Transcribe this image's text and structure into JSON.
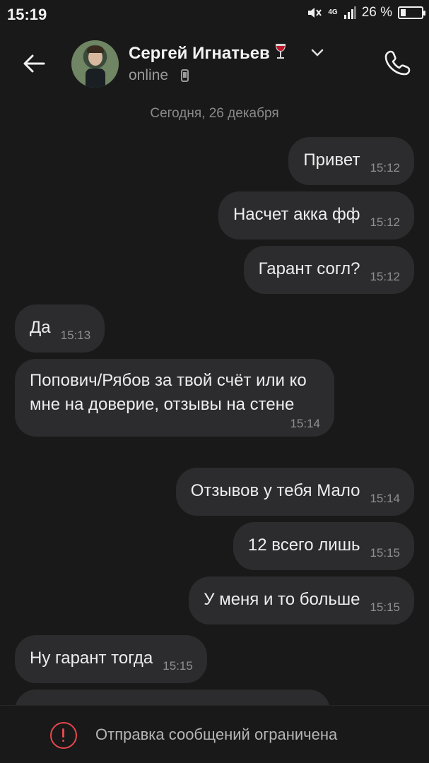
{
  "status_bar": {
    "time": "15:19",
    "network": "4G",
    "battery_text": "26 %",
    "battery_level": 0.26
  },
  "header": {
    "contact_name": "Сергей Игнатьев",
    "status": "online"
  },
  "chat": {
    "date_separator": "Сегодня, 26 декабря",
    "messages": [
      {
        "direction": "out",
        "text": "Привет",
        "time": "15:12"
      },
      {
        "direction": "out",
        "text": "Насчет акка фф",
        "time": "15:12"
      },
      {
        "direction": "out",
        "text": "Гарант согл?",
        "time": "15:12"
      },
      {
        "direction": "in",
        "text": "Да",
        "time": "15:13"
      },
      {
        "direction": "in",
        "text": "Попович/Рябов за твой счёт или ко мне на доверие, отзывы на стене",
        "time": "15:14"
      },
      {
        "direction": "out",
        "text": "Отзывов у тебя Мало",
        "time": "15:14"
      },
      {
        "direction": "out",
        "text": "12 всего лишь",
        "time": "15:15"
      },
      {
        "direction": "out",
        "text": "У меня и то больше",
        "time": "15:15"
      },
      {
        "direction": "in",
        "text": "Ну гарант тогда",
        "time": "15:15"
      }
    ]
  },
  "bottom_bar": {
    "restricted_text": "Отправка сообщений ограничена"
  },
  "colors": {
    "background": "#191919",
    "bubble": "#2c2c2e",
    "warning": "#e5484d"
  }
}
